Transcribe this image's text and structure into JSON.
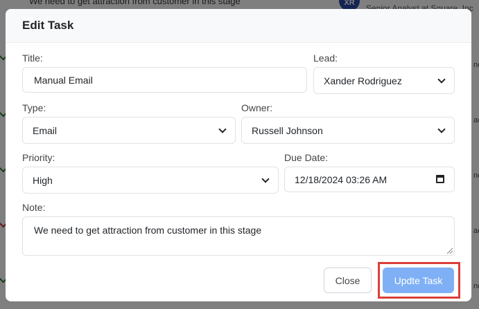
{
  "background": {
    "top_text": "We need to get attraction from customer in this stage",
    "avatar_initials": "XR",
    "job_text": "Senior Analyst at Square, Inc",
    "side_fragments": [
      "nc",
      "ac.",
      "nc",
      "ac.",
      "nc"
    ]
  },
  "modal": {
    "title": "Edit Task",
    "title_field": {
      "label": "Title:",
      "value": "Manual Email"
    },
    "lead_field": {
      "label": "Lead:",
      "value": "Xander Rodriguez"
    },
    "type_field": {
      "label": "Type:",
      "value": "Email"
    },
    "owner_field": {
      "label": "Owner:",
      "value": "Russell Johnson"
    },
    "priority_field": {
      "label": "Priority:",
      "value": "High"
    },
    "due_date_field": {
      "label": "Due Date:",
      "value": "12/18/2024 03:26 AM"
    },
    "note_field": {
      "label": "Note:",
      "value": "We need to get attraction from customer in this stage"
    },
    "buttons": {
      "close": "Close",
      "update": "Updte Task"
    }
  },
  "colors": {
    "overlay": "#000000",
    "update_button": "#7fb0f5",
    "highlight_border": "#d9403a",
    "header_bg": "#f8f9fa"
  },
  "icons": [
    "chevron-down-icon",
    "calendar-icon",
    "check-icon",
    "resize-grip-icon"
  ]
}
